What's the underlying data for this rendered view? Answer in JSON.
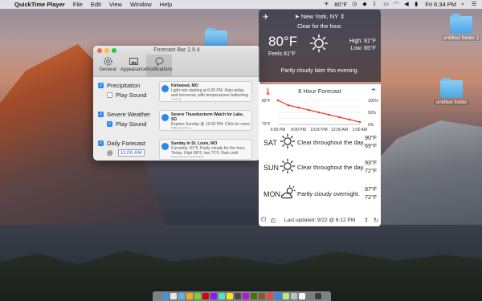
{
  "menubar": {
    "app_name": "QuickTime Player",
    "items": [
      "File",
      "Edit",
      "View",
      "Window",
      "Help"
    ],
    "temp": "80°F",
    "clock": "Fri 6:34 PM"
  },
  "desktop_icons": [
    "untitled folder 2",
    "untitled folder"
  ],
  "prefs": {
    "title": "Forecast Bar 2.9.4",
    "tabs": [
      "General",
      "Appearance",
      "Notifications"
    ],
    "rows": [
      {
        "label": "Precipitation",
        "checked": true,
        "sub_label": "Play Sound",
        "sub_checked": false,
        "notif_title": "Kirkwood, MO",
        "notif_body": "Light rain starting at 6:09 PM. Rain today and tomorrow, with temperatures bottoming out at..."
      },
      {
        "label": "Severe Weather",
        "checked": true,
        "sub_label": "Play Sound",
        "sub_checked": true,
        "notif_title": "Severe Thunderstorm Watch for Lake, SD",
        "notif_body": "Expires Sunday @ 10:00 PM. Click for more information."
      },
      {
        "label": "Daily Forecast",
        "checked": true,
        "sub_label": "@",
        "time": "11:00 AM",
        "notif_title": "Sunday in St. Louis, MO",
        "notif_body": "Currently: 81°F, Partly cloudy for the hour. Today: High 88°F, low 72°F. Rain until tomorrow morning."
      }
    ]
  },
  "forecast": {
    "location": "New York, NY",
    "summary": "Clear for the hour.",
    "temp": "80°F",
    "feels": "Feels 81°F",
    "high_label": "High:",
    "high": "81°F",
    "low_label": "Low:",
    "low": "65°F",
    "later": "Partly cloudy later this evening.",
    "hourly_title": "8 Hour Forecast",
    "days": [
      {
        "name": "SAT",
        "icon": "sun-icon",
        "summary": "Clear throughout the day.",
        "high": "90°F",
        "low": "69°F"
      },
      {
        "name": "SUN",
        "icon": "sun-icon",
        "summary": "Clear throughout the day.",
        "high": "93°F",
        "low": "72°F"
      },
      {
        "name": "MON",
        "icon": "partly-cloudy-icon",
        "summary": "Partly cloudy overnight.",
        "high": "87°F",
        "low": "72°F"
      }
    ],
    "updated": "Last updated: 9/22 @ 6:12 PM",
    "colors": {
      "temp_line": "#e0452b",
      "precip": "#2d86f2"
    }
  },
  "chart_data": {
    "type": "line",
    "title": "8 Hour Forecast",
    "x": [
      "6:00 PM",
      "7:00 PM",
      "8:00 PM",
      "9:00 PM",
      "10:00 PM",
      "11:00 PM",
      "12:00 AM",
      "1:00 AM",
      "2:00 AM"
    ],
    "x_ticks": [
      "6:00 PM",
      "8:00 PM",
      "10:00 PM",
      "12:00 AM",
      "2:00 AM"
    ],
    "series": [
      {
        "values": [
          80,
          78,
          77,
          76,
          75,
          74,
          73,
          72,
          71
        ]
      }
    ],
    "ylim": [
      70,
      80
    ],
    "y_ticks": [
      "80°F",
      "70°F"
    ],
    "y2_ticks": [
      "100%",
      "50%",
      "0%"
    ],
    "grid": true
  }
}
